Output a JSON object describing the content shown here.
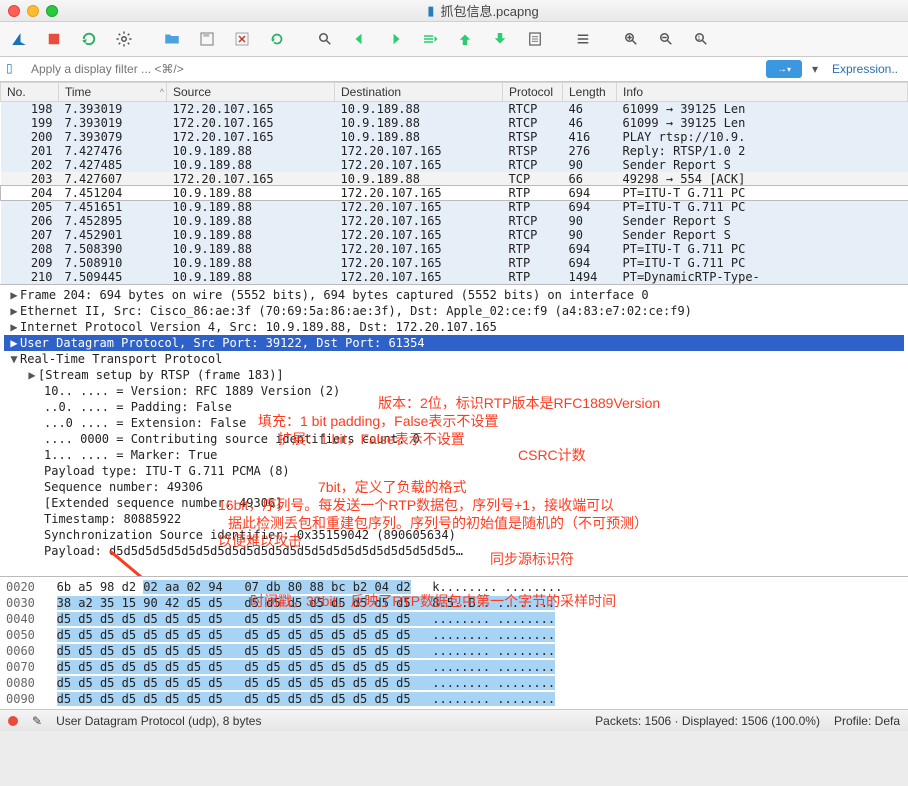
{
  "window": {
    "title": "抓包信息.pcapng"
  },
  "filter": {
    "placeholder": "Apply a display filter ... <⌘/>",
    "expression_label": "Expression.."
  },
  "columns": {
    "no": "No.",
    "time": "Time",
    "source": "Source",
    "destination": "Destination",
    "protocol": "Protocol",
    "length": "Length",
    "info": "Info"
  },
  "packets": [
    {
      "no": "198",
      "time": "7.393019",
      "src": "172.20.107.165",
      "dst": "10.9.189.88",
      "proto": "RTCP",
      "len": "46",
      "info": "61099 → 39125 Len",
      "cls": "row"
    },
    {
      "no": "199",
      "time": "7.393019",
      "src": "172.20.107.165",
      "dst": "10.9.189.88",
      "proto": "RTCP",
      "len": "46",
      "info": "61099 → 39125 Len",
      "cls": "row"
    },
    {
      "no": "200",
      "time": "7.393079",
      "src": "172.20.107.165",
      "dst": "10.9.189.88",
      "proto": "RTSP",
      "len": "416",
      "info": "PLAY rtsp://10.9.",
      "cls": "row"
    },
    {
      "no": "201",
      "time": "7.427476",
      "src": "10.9.189.88",
      "dst": "172.20.107.165",
      "proto": "RTSP",
      "len": "276",
      "info": "Reply: RTSP/1.0 2",
      "cls": "row"
    },
    {
      "no": "202",
      "time": "7.427485",
      "src": "10.9.189.88",
      "dst": "172.20.107.165",
      "proto": "RTCP",
      "len": "90",
      "info": "Sender Report   S",
      "cls": "row"
    },
    {
      "no": "203",
      "time": "7.427607",
      "src": "172.20.107.165",
      "dst": "10.9.189.88",
      "proto": "TCP",
      "len": "66",
      "info": "49298 → 554 [ACK]",
      "cls": "row light"
    },
    {
      "no": "204",
      "time": "7.451204",
      "src": "10.9.189.88",
      "dst": "172.20.107.165",
      "proto": "RTP",
      "len": "694",
      "info": "PT=ITU-T G.711 PC",
      "cls": "row sel"
    },
    {
      "no": "205",
      "time": "7.451651",
      "src": "10.9.189.88",
      "dst": "172.20.107.165",
      "proto": "RTP",
      "len": "694",
      "info": "PT=ITU-T G.711 PC",
      "cls": "row"
    },
    {
      "no": "206",
      "time": "7.452895",
      "src": "10.9.189.88",
      "dst": "172.20.107.165",
      "proto": "RTCP",
      "len": "90",
      "info": "Sender Report   S",
      "cls": "row"
    },
    {
      "no": "207",
      "time": "7.452901",
      "src": "10.9.189.88",
      "dst": "172.20.107.165",
      "proto": "RTCP",
      "len": "90",
      "info": "Sender Report   S",
      "cls": "row"
    },
    {
      "no": "208",
      "time": "7.508390",
      "src": "10.9.189.88",
      "dst": "172.20.107.165",
      "proto": "RTP",
      "len": "694",
      "info": "PT=ITU-T G.711 PC",
      "cls": "row"
    },
    {
      "no": "209",
      "time": "7.508910",
      "src": "10.9.189.88",
      "dst": "172.20.107.165",
      "proto": "RTP",
      "len": "694",
      "info": "PT=ITU-T G.711 PC",
      "cls": "row"
    },
    {
      "no": "210",
      "time": "7.509445",
      "src": "10.9.189.88",
      "dst": "172.20.107.165",
      "proto": "RTP",
      "len": "1494",
      "info": "PT=DynamicRTP-Type-",
      "cls": "row"
    }
  ],
  "details": {
    "frame": "Frame 204: 694 bytes on wire (5552 bits), 694 bytes captured (5552 bits) on interface 0",
    "eth": "Ethernet II, Src: Cisco_86:ae:3f (70:69:5a:86:ae:3f), Dst: Apple_02:ce:f9 (a4:83:e7:02:ce:f9)",
    "ip": "Internet Protocol Version 4, Src: 10.9.189.88, Dst: 172.20.107.165",
    "udp": "User Datagram Protocol, Src Port: 39122, Dst Port: 61354",
    "rtp": "Real-Time Transport Protocol",
    "stream": "[Stream setup by RTSP (frame 183)]",
    "version": "10.. .... = Version: RFC 1889 Version (2)",
    "padding": "..0. .... = Padding: False",
    "ext": "...0 .... = Extension: False",
    "cc": ".... 0000 = Contributing source identifiers count: 0",
    "marker": "1... .... = Marker: True",
    "pt": "Payload type: ITU-T G.711 PCMA (8)",
    "seq": "Sequence number: 49306",
    "eseq": "[Extended sequence number: 49306]",
    "ts": "Timestamp: 80885922",
    "ssrc": "Synchronization Source identifier: 0x35159042 (890605634)",
    "payload": "Payload: d5d5d5d5d5d5d5d5d5d5d5d5d5d5d5d5d5d5d5d5d5d5d5d5…"
  },
  "annotations": {
    "a1": "版本：2位，标识RTP版本是RFC1889Version",
    "a2": "填充：1 bit padding，False表示不设置",
    "a3": "扩展：1 bit，False表示不设置",
    "a4": "CSRC计数",
    "a5": "7bit，定义了负载的格式",
    "a6": "16bit，序列号。每发送一个RTP数据包，序列号+1，接收端可以",
    "a6b": "据此检测丢包和重建包序列。序列号的初始值是随机的（不可预测）",
    "a6c": "以便难以攻击",
    "a7": "同步源标识符",
    "a8": "时间戳，32bit，反映了RTP数据包中第一个字节的采样时间"
  },
  "hex": {
    "l0020": {
      "off": "0020",
      "b": "6b a5 98 d2 ",
      "h": "02 aa 02 94   07 db 80 88 bc b2 04 d2",
      "a": "   k........ ........"
    },
    "l0030": {
      "off": "0030",
      "b": "",
      "h": "38 a2 35 15 90 42 d5 d5   d5 d5 d5 d5 d5 d5 d5 d5",
      "a": "   8.5..B.. ........"
    },
    "l0040": {
      "off": "0040",
      "b": "",
      "h": "d5 d5 d5 d5 d5 d5 d5 d5   d5 d5 d5 d5 d5 d5 d5 d5",
      "a": "   ........ ........"
    },
    "l0050": {
      "off": "0050",
      "b": "",
      "h": "d5 d5 d5 d5 d5 d5 d5 d5   d5 d5 d5 d5 d5 d5 d5 d5",
      "a": "   ........ ........"
    },
    "l0060": {
      "off": "0060",
      "b": "",
      "h": "d5 d5 d5 d5 d5 d5 d5 d5   d5 d5 d5 d5 d5 d5 d5 d5",
      "a": "   ........ ........"
    },
    "l0070": {
      "off": "0070",
      "b": "",
      "h": "d5 d5 d5 d5 d5 d5 d5 d5   d5 d5 d5 d5 d5 d5 d5 d5",
      "a": "   ........ ........"
    },
    "l0080": {
      "off": "0080",
      "b": "",
      "h": "d5 d5 d5 d5 d5 d5 d5 d5   d5 d5 d5 d5 d5 d5 d5 d5",
      "a": "   ........ ........"
    },
    "l0090": {
      "off": "0090",
      "b": "",
      "h": "d5 d5 d5 d5 d5 d5 d5 d5   d5 d5 d5 d5 d5 d5 d5 d5",
      "a": "   ........ ........"
    }
  },
  "status": {
    "proto": "User Datagram Protocol (udp), 8 bytes",
    "packets": "Packets: 1506 · Displayed: 1506 (100.0%)",
    "profile": "Profile: Defa"
  }
}
